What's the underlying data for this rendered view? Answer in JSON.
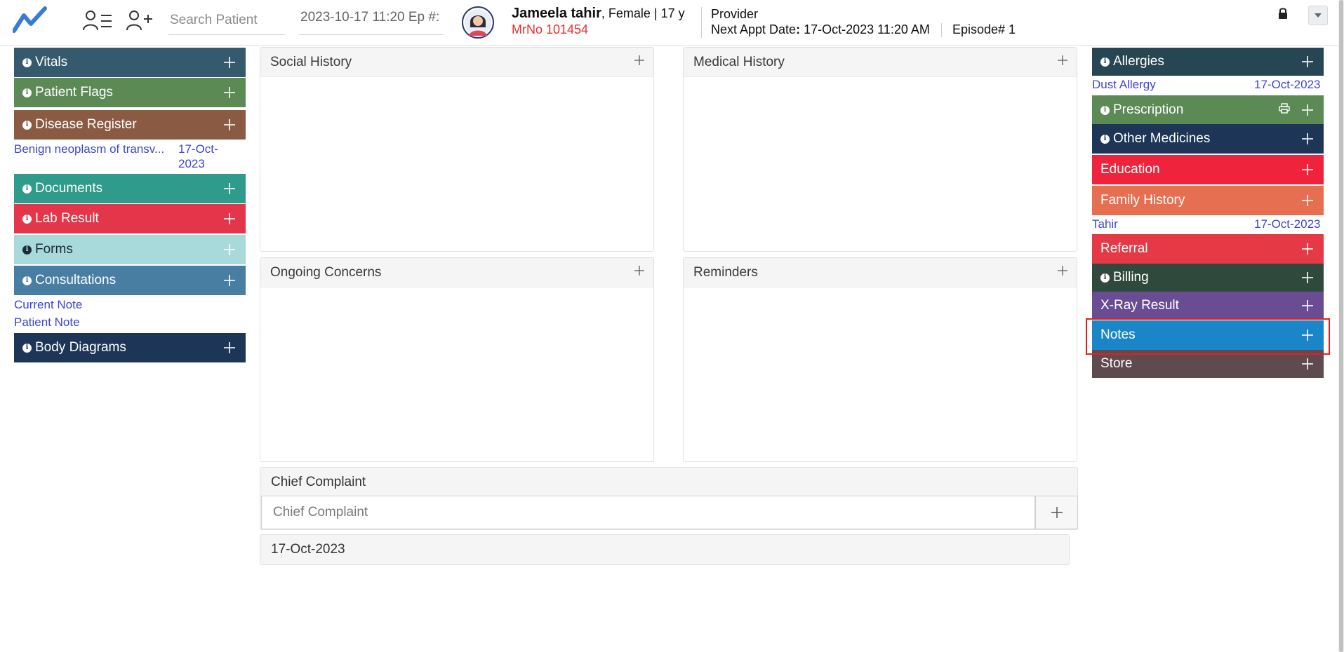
{
  "header": {
    "search": {
      "placeholder": "Search Patient"
    },
    "episode_field": "2023-10-17 11:20 Ep #:",
    "patient": {
      "name": "Jameela tahir",
      "meta": ", Female | 17 y",
      "mrno": "MrNo 101454"
    },
    "provider_label": "Provider",
    "next_appt_label": "Next Appt Date",
    "next_appt_sep": ":",
    "next_appt_value": " 17-Oct-2023 11:20 AM",
    "episode": "Episode# 1"
  },
  "left_panels": {
    "vitals": "Vitals",
    "patient_flags": "Patient Flags",
    "disease_register": "Disease Register",
    "disease_item": {
      "name": "Benign neoplasm of transv...",
      "date_line1": "17-Oct-",
      "date_line2": "2023"
    },
    "documents": "Documents",
    "lab_result": "Lab Result",
    "forms": "Forms",
    "consultations": "Consultations",
    "current_note": "Current Note",
    "patient_note": "Patient Note",
    "body_diagrams": "Body Diagrams"
  },
  "center": {
    "social_history": "Social History",
    "medical_history": "Medical History",
    "ongoing_concerns": "Ongoing Concerns",
    "reminders": "Reminders",
    "chief_complaint_title": "Chief Complaint",
    "chief_complaint_placeholder": "Chief Complaint",
    "entry_date": "17-Oct-2023"
  },
  "right_panels": {
    "allergies": "Allergies",
    "allergy_item": {
      "name": "Dust Allergy",
      "date": "17-Oct-2023"
    },
    "prescription": "Prescription",
    "other_medicines": "Other Medicines",
    "education": "Education",
    "family_history": "Family History",
    "family_item": {
      "name": "Tahir",
      "date": "17-Oct-2023"
    },
    "referral": "Referral",
    "billing": "Billing",
    "xray_result": "X-Ray Result",
    "notes": "Notes",
    "store": "Store"
  },
  "colors": {
    "vitals": "#355a6e",
    "patient_flags": "#5b8a55",
    "disease_register": "#8b5a42",
    "documents": "#2e9b8c",
    "lab_result": "#e3364a",
    "forms": "#a8dadb",
    "consultations": "#477ea2",
    "body_diagrams": "#1d3557",
    "allergies": "#264653",
    "prescription": "#5b8a55",
    "other_medicines": "#1d3557",
    "education": "#ef233c",
    "family_history": "#e76f51",
    "referral": "#e63946",
    "billing": "#2f4a3d",
    "xray_result": "#6a4c93",
    "notes": "#1a86c8",
    "store": "#5e4a4f",
    "link": "#3b45d8",
    "mrno": "#e8302f",
    "highlight": "#e02020"
  },
  "icons": {
    "logo": "trend-line-logo",
    "patient_list": "user-list-icon",
    "add_patient": "user-plus-icon",
    "avatar": "female-avatar",
    "lock": "lock-icon",
    "dropdown": "caret-down-icon",
    "info": "info-icon",
    "add": "plus-icon",
    "print": "print-icon"
  }
}
